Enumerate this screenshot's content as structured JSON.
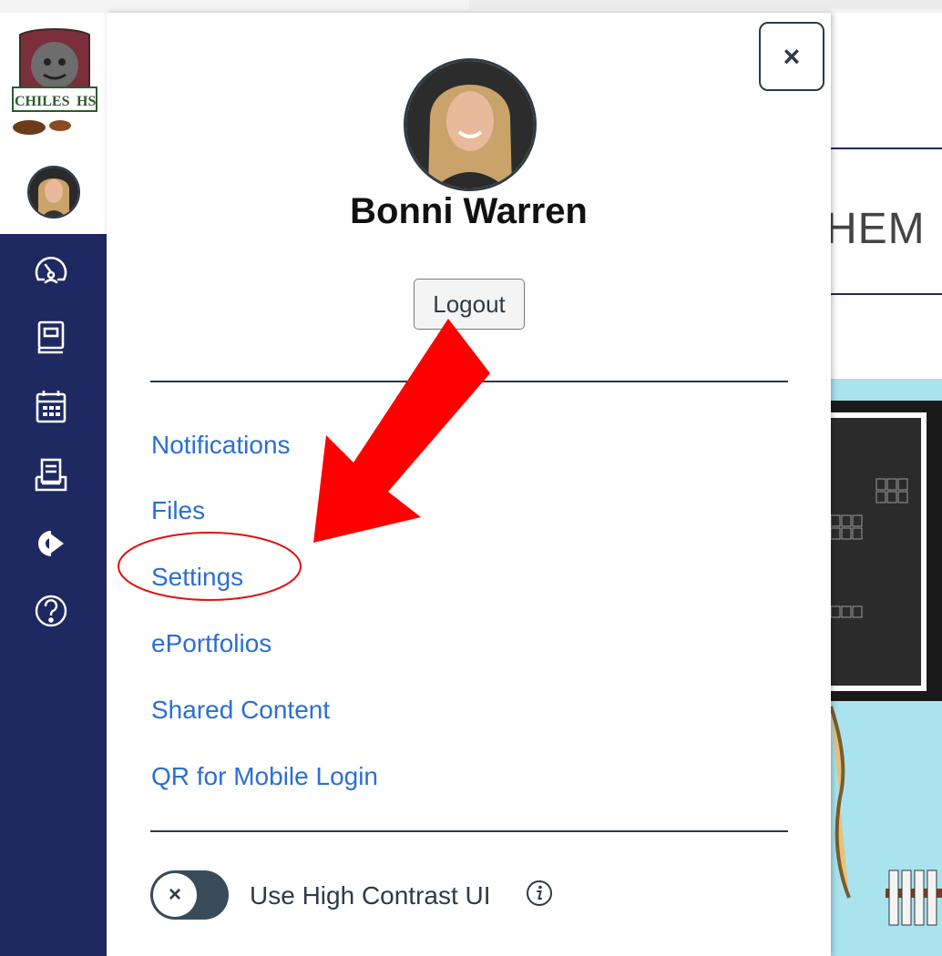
{
  "profile": {
    "name": "Bonni Warren",
    "logout_label": "Logout"
  },
  "tray": {
    "close_label": "×",
    "links": [
      {
        "label": "Notifications"
      },
      {
        "label": "Files"
      },
      {
        "label": "Settings"
      },
      {
        "label": "ePortfolios"
      },
      {
        "label": "Shared Content"
      },
      {
        "label": "QR for Mobile Login"
      }
    ],
    "high_contrast": {
      "label": "Use High Contrast UI",
      "toggle_symbol": "×",
      "enabled": false
    }
  },
  "logo": {
    "text_left": "CHILES",
    "text_right": "HS"
  },
  "background_page": {
    "title_fragment": "HEM"
  },
  "nav_icons": [
    "dashboard-icon",
    "courses-icon",
    "calendar-icon",
    "inbox-icon",
    "commons-icon",
    "help-icon"
  ],
  "colors": {
    "nav_bg": "#1e2861",
    "link": "#2b6fd1",
    "annotation_red": "#ff0000",
    "course_image_bg": "#a9e4ee"
  }
}
